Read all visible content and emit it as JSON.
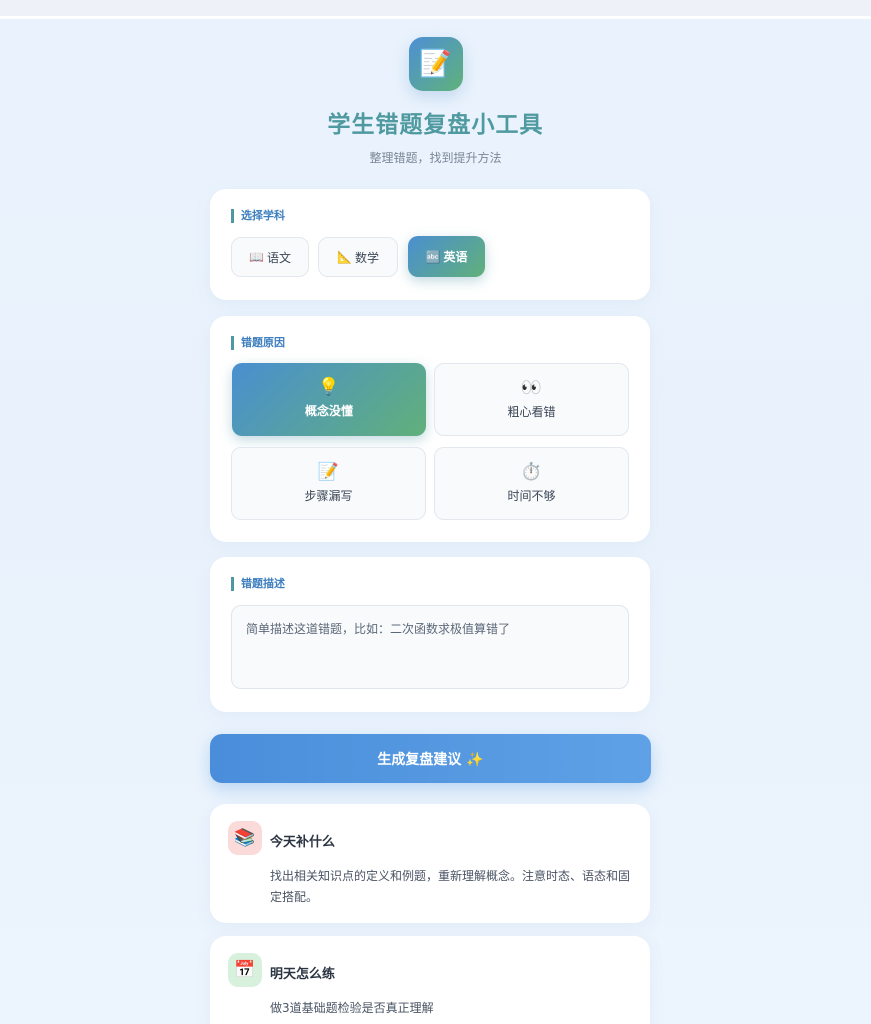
{
  "header": {
    "logo_icon": "📝",
    "title": "学生错题复盘小工具",
    "subtitle": "整理错题，找到提升方法"
  },
  "subject": {
    "label": "选择学科",
    "options": [
      {
        "icon": "📖",
        "label": "语文",
        "selected": false
      },
      {
        "icon": "📐",
        "label": "数学",
        "selected": false
      },
      {
        "icon": "🔤",
        "label": "英语",
        "selected": true
      }
    ]
  },
  "reason": {
    "label": "错题原因",
    "options": [
      {
        "icon": "💡",
        "label": "概念没懂",
        "selected": true
      },
      {
        "icon": "👀",
        "label": "粗心看错",
        "selected": false
      },
      {
        "icon": "📝",
        "label": "步骤漏写",
        "selected": false
      },
      {
        "icon": "⏱️",
        "label": "时间不够",
        "selected": false
      }
    ]
  },
  "description": {
    "label": "错题描述",
    "placeholder": "简单描述这道错题，比如：二次函数求极值算错了"
  },
  "generate_button": {
    "label": "生成复盘建议 ✨"
  },
  "results": [
    {
      "icon": "📚",
      "icon_bg": "#fbdada",
      "title": "今天补什么",
      "body": "找出相关知识点的定义和例题，重新理解概念。注意时态、语态和固定搭配。"
    },
    {
      "icon": "📅",
      "icon_bg": "#d8f1dc",
      "title": "明天怎么练",
      "body": "做3道基础题检验是否真正理解"
    }
  ],
  "colors": {
    "accent_gradient_start": "#4a8fd1",
    "accent_gradient_end": "#61b07a",
    "title": "#4f9aa0",
    "button": "#4a8edb"
  }
}
